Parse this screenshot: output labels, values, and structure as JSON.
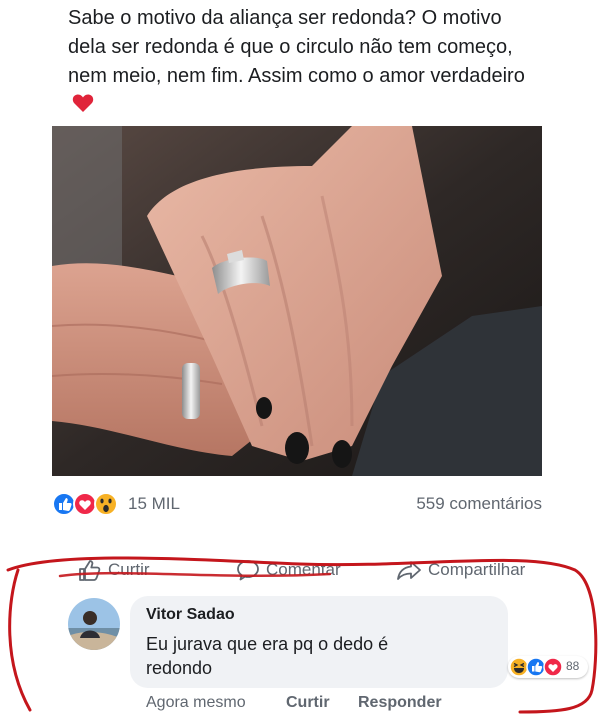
{
  "post": {
    "text": "Sabe o motivo da aliança ser redonda? O motivo dela ser redonda é que o circulo não tem começo, nem meio, nem fim. Assim como o amor verdadeiro"
  },
  "stats": {
    "reactions_count": "15 MIL",
    "comments_count": "559 comentários",
    "reaction_icons": [
      "like-icon",
      "love-icon",
      "wow-icon"
    ]
  },
  "actions": {
    "like_label": "Curtir",
    "comment_label": "Comentar",
    "share_label": "Compartilhar"
  },
  "comment": {
    "author": "Vitor Sadao",
    "text": "Eu jurava que era pq o dedo é redondo",
    "reaction_count": "88",
    "reaction_icons": [
      "haha-icon",
      "like-icon",
      "love-icon"
    ],
    "time": "Agora mesmo",
    "like_label": "Curtir",
    "reply_label": "Responder"
  },
  "colors": {
    "like_blue": "#1877f2",
    "love_red": "#f02849",
    "wow_yellow": "#f7b125",
    "annotation_red": "#c4161c",
    "bubble_bg": "#f0f2f5",
    "secondary_text": "#606770"
  }
}
